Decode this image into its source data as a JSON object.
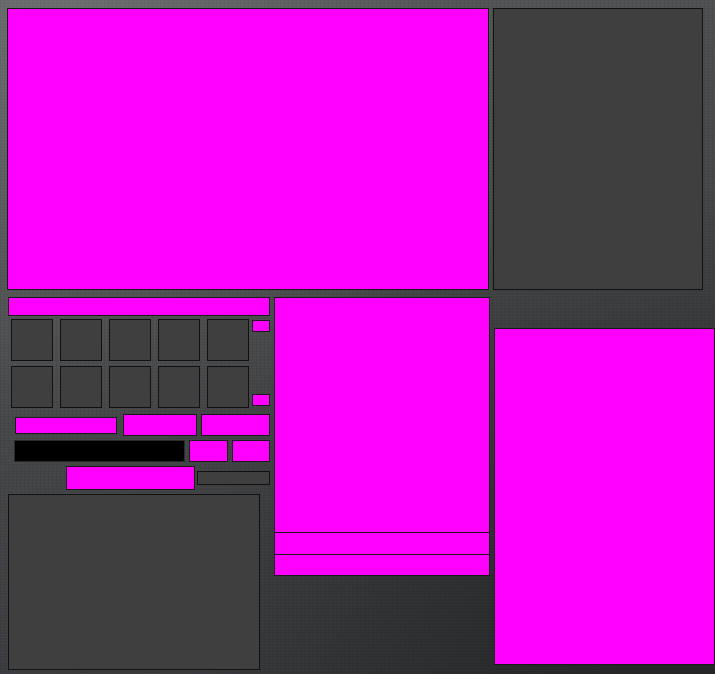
{
  "screen": {
    "placeholder_color": "#ff00ff",
    "panel_color": "#3f3f3f",
    "input_color": "#000000"
  },
  "inventory": {
    "rows": 2,
    "columns": 5
  }
}
